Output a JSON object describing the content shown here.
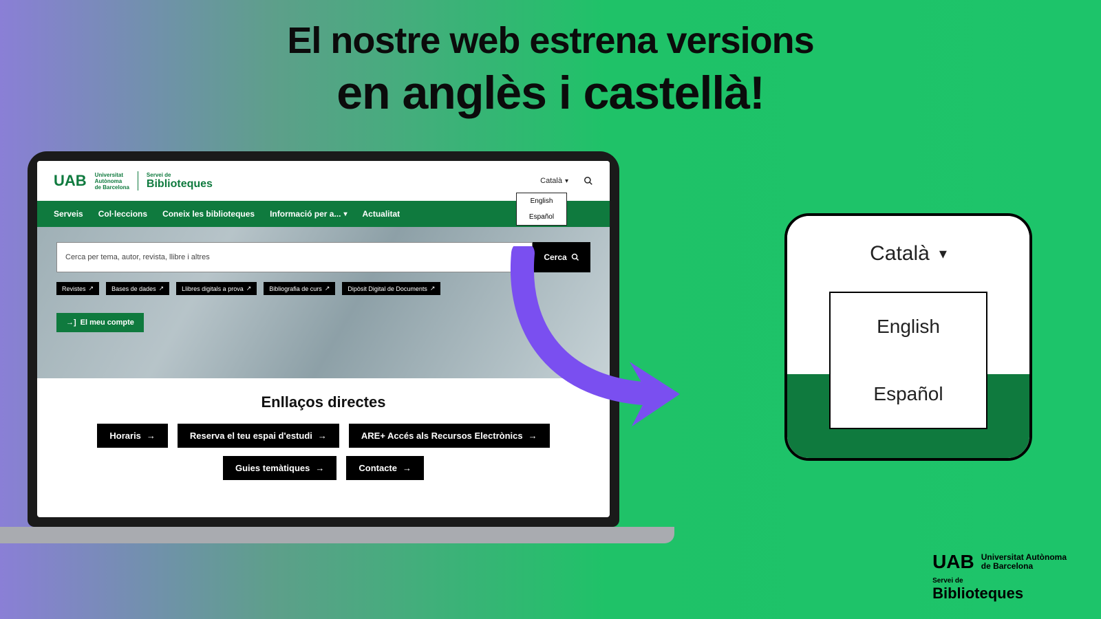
{
  "headline": {
    "line1": "El nostre web estrena versions",
    "line2": "en anglès i castellà!"
  },
  "screen": {
    "logo": {
      "uab": "UAB",
      "sub1": "Universitat",
      "sub2": "Autònoma",
      "sub3": "de Barcelona",
      "servei": "Servei de",
      "biblio": "Biblioteques"
    },
    "lang": {
      "current": "Català",
      "opt1": "English",
      "opt2": "Español"
    },
    "nav": {
      "serveis": "Serveis",
      "colleccions": "Col·leccions",
      "coneix": "Coneix les biblioteques",
      "info": "Informació per a...",
      "actualitat": "Actualitat"
    },
    "search": {
      "placeholder": "Cerca per tema, autor, revista, llibre i altres",
      "button": "Cerca"
    },
    "quicklinks": {
      "revistes": "Revistes",
      "bases": "Bases de dades",
      "llibres": "Llibres digitals a prova",
      "biblio": "Bibliografia de curs",
      "diposit": "Dipòsit Digital de Documents"
    },
    "account": "El meu compte",
    "directes": {
      "title": "Enllaços directes",
      "horaris": "Horaris",
      "reserva": "Reserva el teu espai d'estudi",
      "are": "ARE+ Accés als Recursos Electrònics",
      "guies": "Guies temàtiques",
      "contacte": "Contacte"
    }
  },
  "zoom": {
    "current": "Català",
    "opt1": "English",
    "opt2": "Español"
  },
  "footer": {
    "uab": "UAB",
    "sub1": "Universitat Autònoma",
    "sub2": "de Barcelona",
    "servei": "Servei de",
    "biblio": "Biblioteques"
  }
}
